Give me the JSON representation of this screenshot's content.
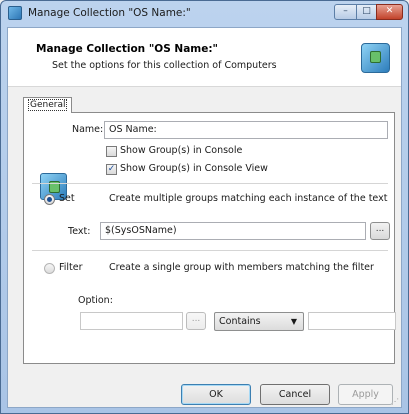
{
  "window": {
    "title": "Manage Collection \"OS Name:\"",
    "controls": {
      "minimize": "–",
      "maximize": "□",
      "close": "✕"
    }
  },
  "header": {
    "title": "Manage Collection \"OS Name:\"",
    "subtitle": "Set the options for this collection of Computers",
    "icon": "computer-collection-icon"
  },
  "tabs": [
    {
      "label": "General",
      "selected": true
    }
  ],
  "general": {
    "name_label": "Name:",
    "name_value": "OS Name:",
    "show_in_console_label": "Show Group(s) in Console",
    "show_in_console_checked": false,
    "show_in_console_view_label": "Show Group(s) in Console View",
    "show_in_console_view_checked": true,
    "set_option": {
      "label": "Set",
      "selected": true,
      "description": "Create multiple groups matching each instance of the text",
      "text_label": "Text:",
      "text_value": "$(SysOSName)",
      "browse_label": "..."
    },
    "filter_option": {
      "label": "Filter",
      "selected": false,
      "description": "Create a single group with members matching the filter",
      "option_label": "Option:",
      "browse_label": "...",
      "operator_selected": "Contains",
      "option_value": "",
      "match_value": ""
    }
  },
  "buttons": {
    "ok": "OK",
    "cancel": "Cancel",
    "apply": "Apply"
  },
  "colors": {
    "title_bar": "#bcd3ee",
    "close_button": "#c2432b",
    "selection": "#1d4f92"
  }
}
